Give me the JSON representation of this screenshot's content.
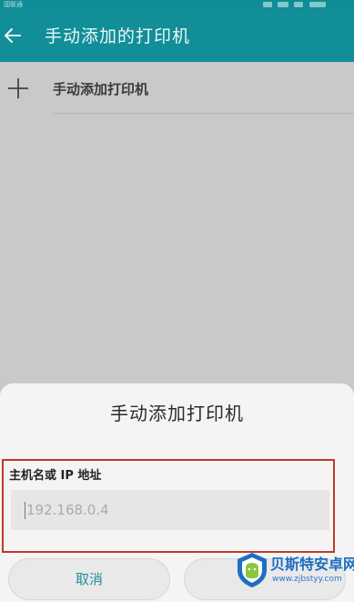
{
  "status_bar": {
    "carrier": "国联通"
  },
  "app_bar": {
    "title": "手动添加的打印机"
  },
  "list": {
    "add_item_label": "手动添加打印机"
  },
  "dialog": {
    "title": "手动添加打印机",
    "field_label": "主机名或 IP 地址",
    "field_placeholder": "192.168.0.4",
    "cancel_label": "取消",
    "confirm_label": ""
  },
  "watermark": {
    "name": "贝斯特安卓网",
    "url": "www.zjbstyy.com"
  },
  "colors": {
    "app_bar": "#128e98",
    "accent": "#1b8f9a",
    "highlight_border": "#c0392b",
    "overlay": "#c9c9c9"
  }
}
